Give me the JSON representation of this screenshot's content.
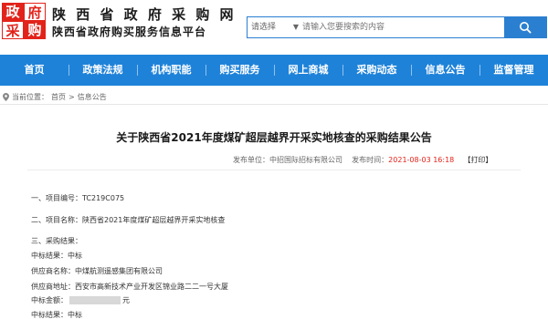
{
  "header": {
    "logo_chars": [
      "政",
      "府",
      "采",
      "购"
    ],
    "site_name": "陕 西 省 政 府 采 购 网",
    "site_sub": "陕西省政府购买服务信息平台",
    "search": {
      "select_label": "请选择",
      "placeholder": "请输入您要搜索的内容"
    }
  },
  "nav": {
    "items": [
      "首页",
      "政策法规",
      "机构职能",
      "购买服务",
      "网上商城",
      "采购动态",
      "信息公告",
      "监督管理"
    ]
  },
  "breadcrumb": {
    "prefix": "当前位置：",
    "home": "首页",
    "separator": ">",
    "current": "信息公告"
  },
  "article": {
    "title": "关于陕西省2021年度煤矿超层越界开采实地核查的采购结果公告",
    "meta_publisher": "发布单位：中招国际招标有限公司",
    "meta_time_label": "发布时间：",
    "meta_time": "2021-08-03 16:18",
    "meta_print": "【打印】",
    "lines": {
      "project_no": "一、项目编号：TC219C075",
      "project_name": "二、项目名称：陕西省2021年度煤矿超层越界开采实地核查",
      "result_head": "三、采购结果：",
      "win_result": "中标结果：中标",
      "supplier": "供应商名称：中煤航测遥感集团有限公司",
      "address": "供应商地址：西安市高新技术产业开发区锦业路二二一号大厦",
      "amount_label": "中标金额：",
      "amount_unit": "元",
      "win_result2": "中标结果：中标"
    }
  },
  "colors": {
    "brand_blue": "#1e82d9",
    "brand_red": "#e2231a"
  }
}
